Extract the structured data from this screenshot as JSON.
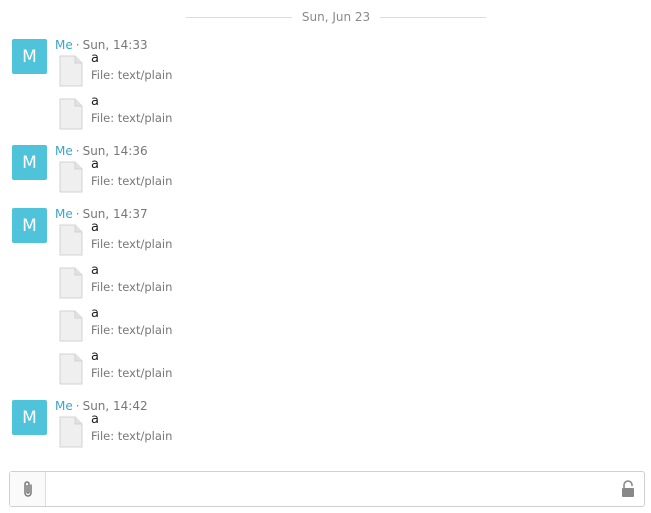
{
  "date_divider": "Sun, Jun 23",
  "groups": [
    {
      "avatar": "M",
      "sender": "Me",
      "separator": "·",
      "time": "Sun, 14:33",
      "attachments": [
        {
          "name": "a",
          "type": "File: text/plain"
        },
        {
          "name": "a",
          "type": "File: text/plain"
        }
      ]
    },
    {
      "avatar": "M",
      "sender": "Me",
      "separator": "·",
      "time": "Sun, 14:36",
      "attachments": [
        {
          "name": "a",
          "type": "File: text/plain"
        }
      ]
    },
    {
      "avatar": "M",
      "sender": "Me",
      "separator": "·",
      "time": "Sun, 14:37",
      "attachments": [
        {
          "name": "a",
          "type": "File: text/plain"
        },
        {
          "name": "a",
          "type": "File: text/plain"
        },
        {
          "name": "a",
          "type": "File: text/plain"
        },
        {
          "name": "a",
          "type": "File: text/plain"
        }
      ]
    },
    {
      "avatar": "M",
      "sender": "Me",
      "separator": "·",
      "time": "Sun, 14:42",
      "attachments": [
        {
          "name": "a",
          "type": "File: text/plain"
        }
      ]
    }
  ],
  "composer": {
    "value": "",
    "placeholder": "",
    "attach_icon": "paperclip-icon",
    "lock_icon": "unlocked-icon"
  },
  "colors": {
    "avatar_bg": "#4fc3d9",
    "sender": "#3aa6c8"
  }
}
